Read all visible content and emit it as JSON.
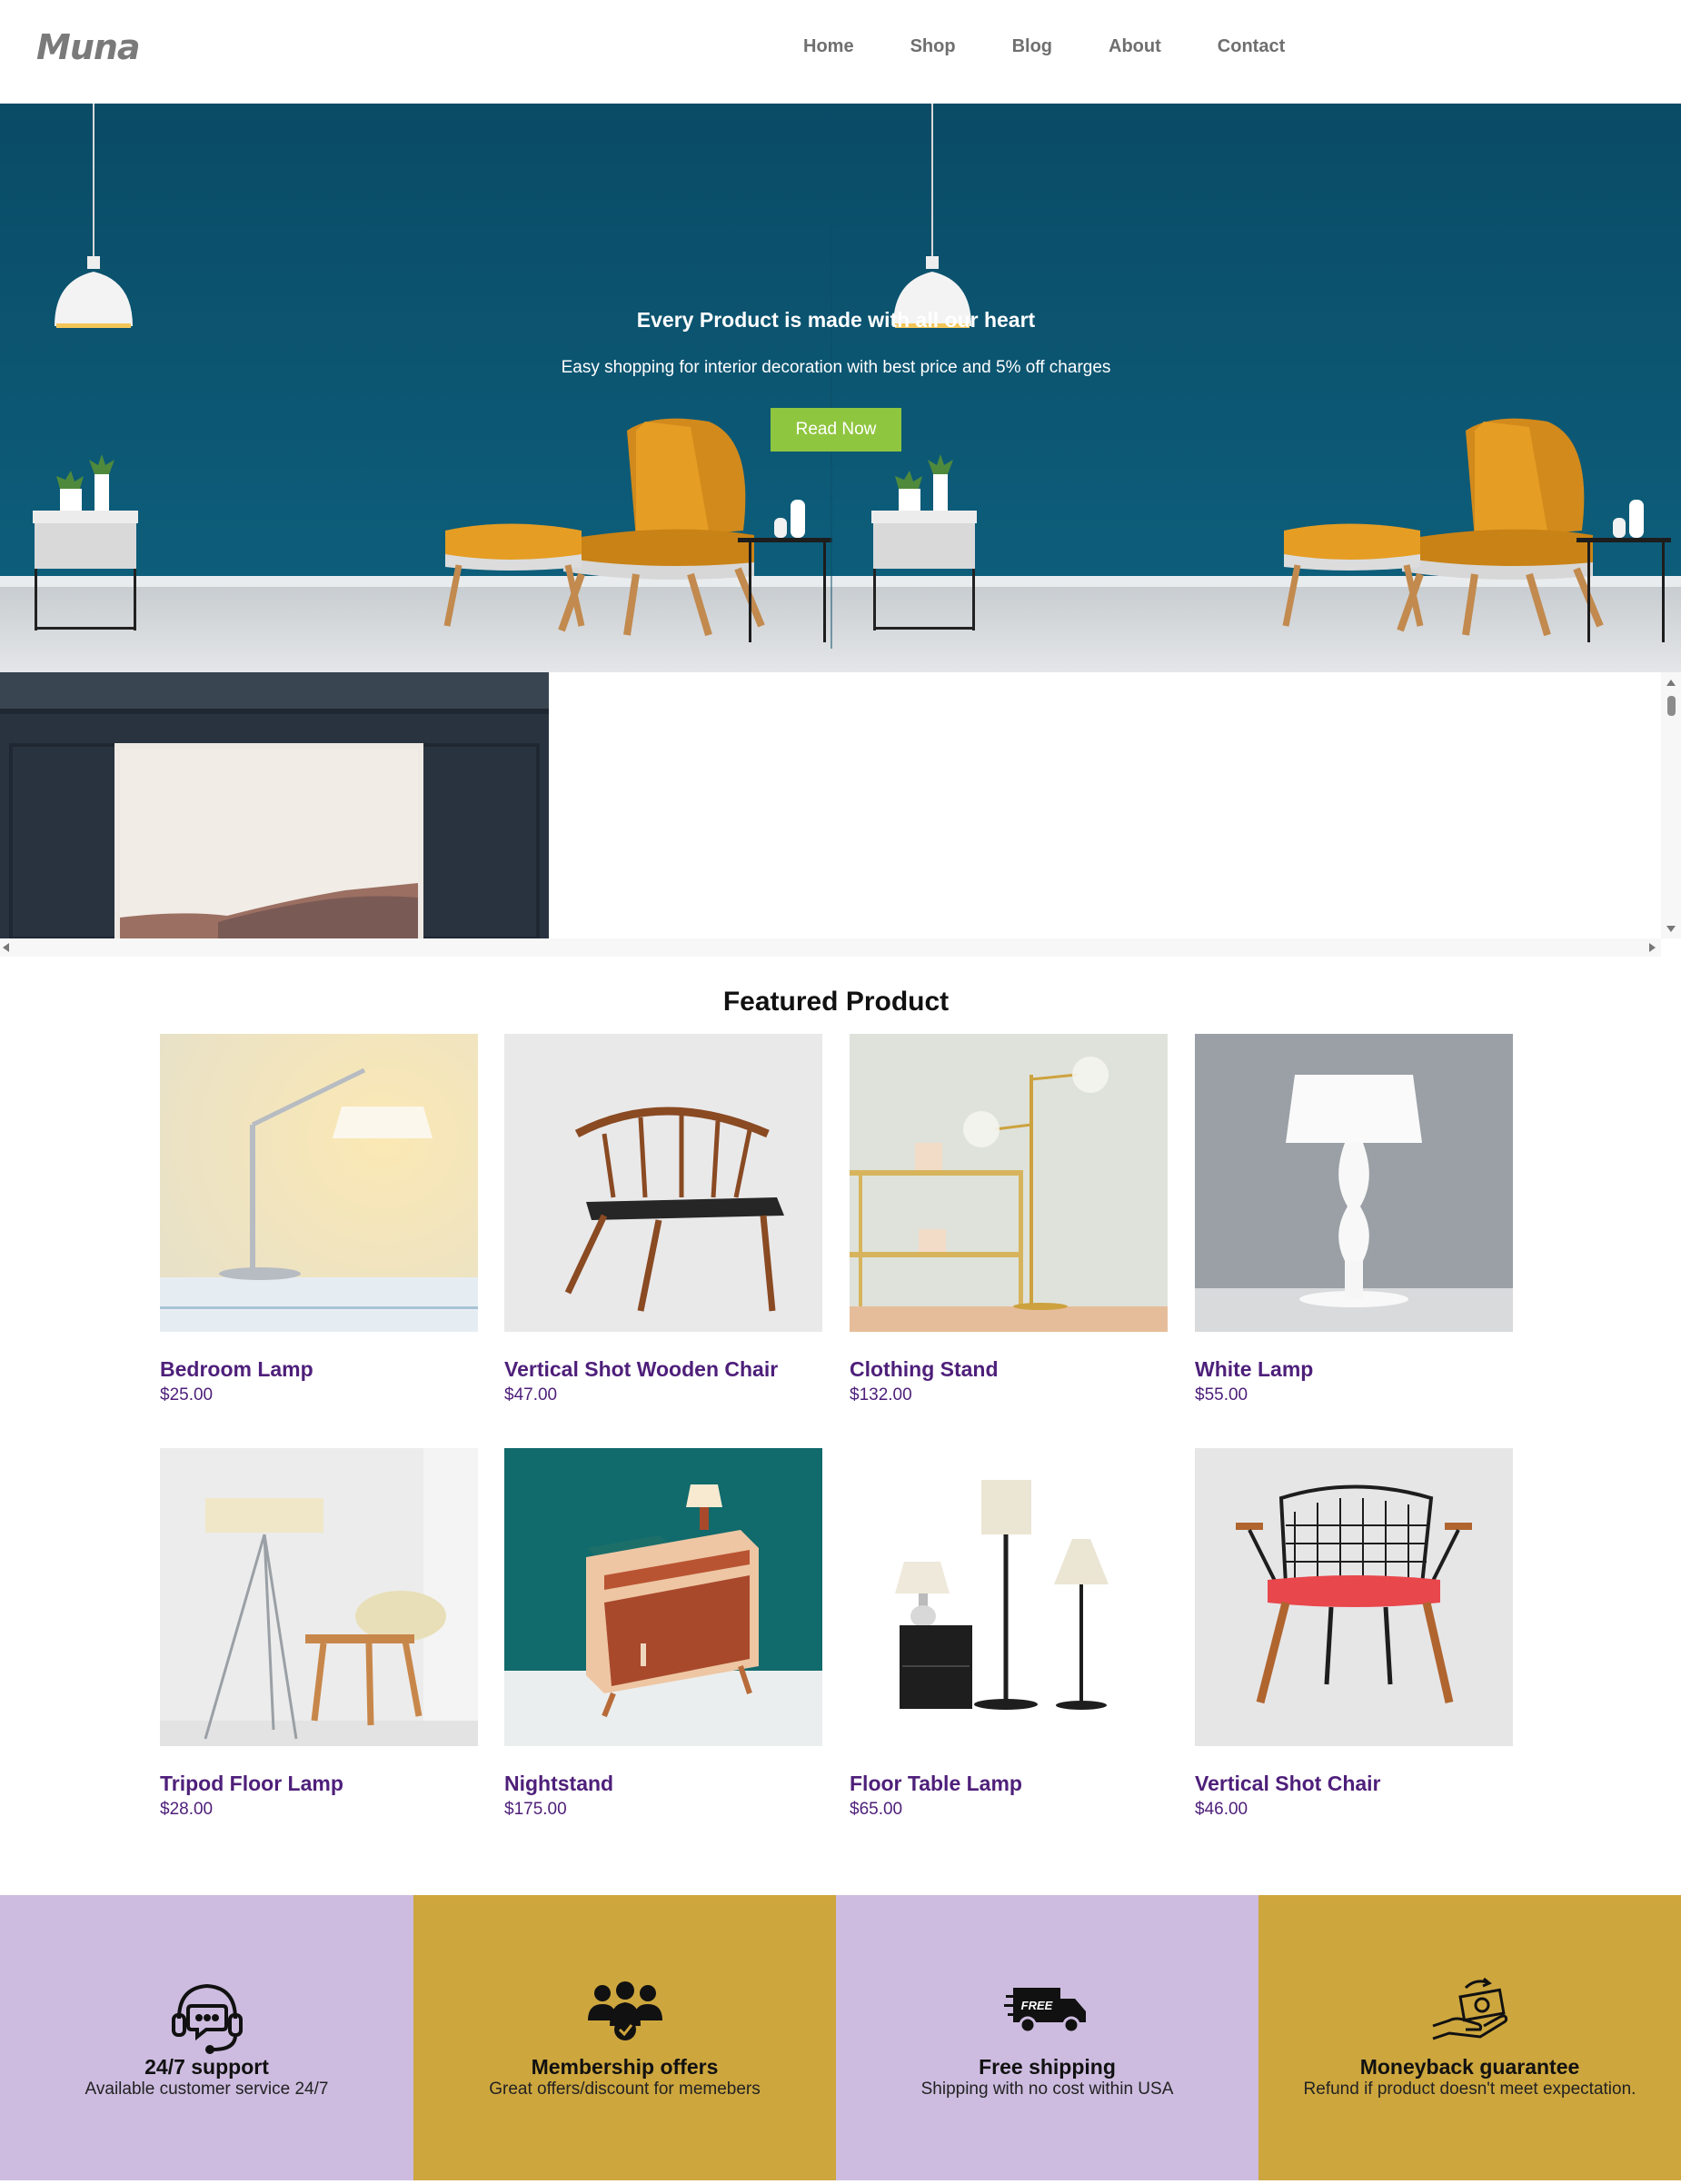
{
  "header": {
    "logo": "Muna",
    "nav": [
      "Home",
      "Shop",
      "Blog",
      "About",
      "Contact"
    ]
  },
  "hero": {
    "title": "Every Product is made with all our heart",
    "subtitle": "Easy shopping for interior decoration with best price and 5% off charges",
    "button": "Read Now"
  },
  "featured": {
    "title": "Featured Product",
    "products": [
      {
        "name": "Bedroom Lamp",
        "price": "$25.00"
      },
      {
        "name": "Vertical Shot Wooden Chair",
        "price": "$47.00"
      },
      {
        "name": "Clothing Stand",
        "price": "$132.00"
      },
      {
        "name": "White Lamp",
        "price": "$55.00"
      },
      {
        "name": "Tripod Floor Lamp",
        "price": "$28.00"
      },
      {
        "name": "Nightstand",
        "price": "$175.00"
      },
      {
        "name": "Floor Table Lamp",
        "price": "$65.00"
      },
      {
        "name": "Vertical Shot Chair",
        "price": "$46.00"
      }
    ]
  },
  "services": [
    {
      "title": "24/7 support",
      "desc": "Available customer service 24/7",
      "icon": "headset-chat-icon",
      "color": "#cdbce0"
    },
    {
      "title": "Membership offers",
      "desc": "Great offers/discount for memebers",
      "icon": "members-icon",
      "color": "#cda63e"
    },
    {
      "title": "Free shipping",
      "desc": "Shipping with no cost within USA",
      "icon": "free-truck-icon",
      "color": "#cdbce0"
    },
    {
      "title": "Moneyback guarantee",
      "desc": "Refund if product doesn't meet expectation.",
      "icon": "money-hand-icon",
      "color": "#cda63e"
    }
  ],
  "colors": {
    "hero_bg": "#0b5471",
    "button": "#8fc63f",
    "product_text": "#4e1f7a"
  }
}
